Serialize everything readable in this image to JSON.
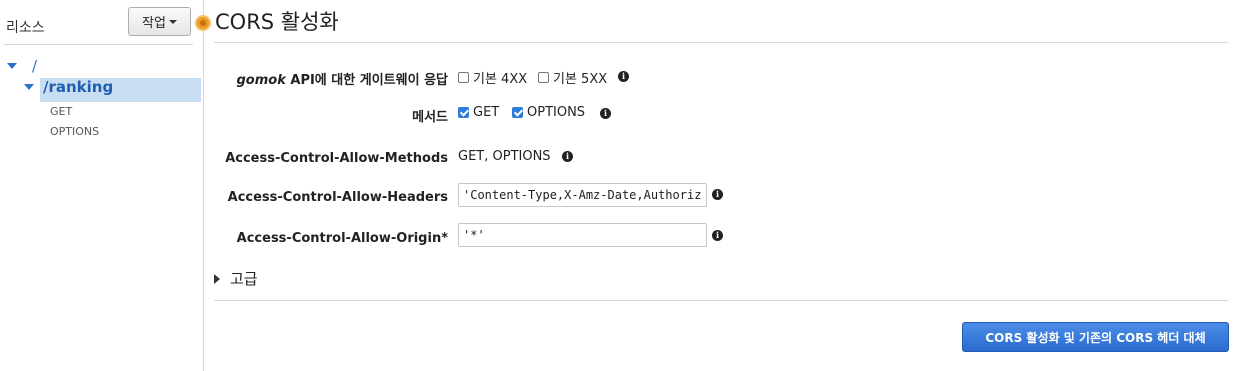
{
  "sidebar": {
    "title": "리소스",
    "action_label": "작업",
    "tree": {
      "root": "/",
      "resource": "/ranking",
      "methods": [
        "GET",
        "OPTIONS"
      ]
    }
  },
  "main": {
    "title": "CORS 활성화",
    "gateway_responses": {
      "label_italic": "gomok",
      "label_rest": " API에 대한 게이트웨이 응답",
      "options": [
        {
          "label": "기본 4XX",
          "checked": false
        },
        {
          "label": "기본 5XX",
          "checked": false
        }
      ]
    },
    "methods": {
      "label": "메서드",
      "options": [
        {
          "label": "GET",
          "checked": true
        },
        {
          "label": "OPTIONS",
          "checked": true
        }
      ]
    },
    "allow_methods": {
      "label": "Access-Control-Allow-Methods",
      "value": "GET, OPTIONS"
    },
    "allow_headers": {
      "label": "Access-Control-Allow-Headers",
      "value": "'Content-Type,X-Amz-Date,Authorization"
    },
    "allow_origin": {
      "label": "Access-Control-Allow-Origin*",
      "value": "'*'"
    },
    "advanced_label": "고급",
    "submit_label": "CORS 활성화 및 기존의 CORS 헤더 대체"
  },
  "icons": {
    "info": "info-icon",
    "caret": "caret-down-icon",
    "expand": "triangle-right-icon"
  },
  "colors": {
    "accent": "#2a72c8",
    "selected_bg": "#c9ddf3",
    "primary_button": "#2a6bd0",
    "status_dot": "#ec9b2a"
  }
}
